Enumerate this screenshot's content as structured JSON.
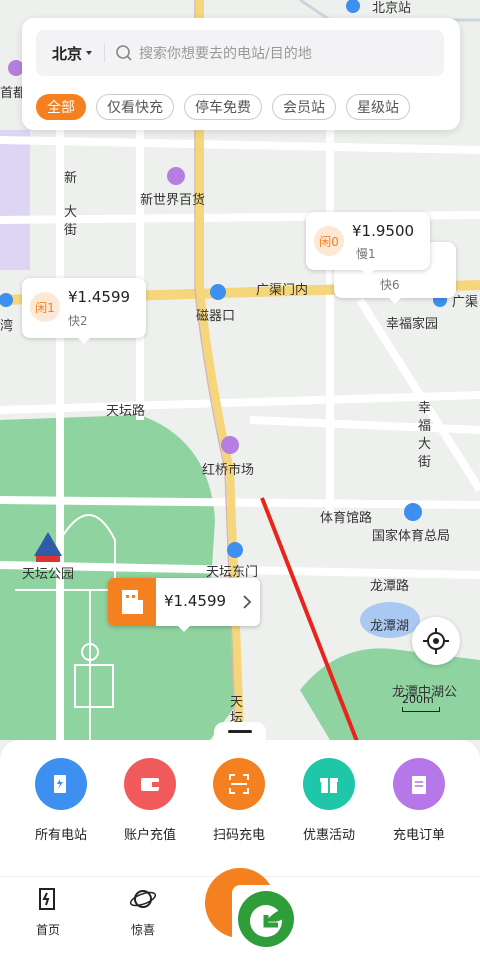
{
  "search": {
    "city": "北京",
    "placeholder": "搜索你想要去的电站/目的地"
  },
  "filters": [
    "全部",
    "仅看快充",
    "停车免费",
    "会员站",
    "星级站"
  ],
  "map_labels": {
    "beijing_station": "北京站",
    "capital": "首都",
    "xinshijie": "新世界百货",
    "xinfang": "新",
    "xinfang2": "大",
    "xinfang3": "街",
    "guangqu": "广渠门内",
    "cikou": "磁器口",
    "xingfu": "幸福家园",
    "tiantan_road": "天坛路",
    "hongqiao": "红桥市场",
    "tiyu": "体育馆路",
    "guojia": "国家体育总局",
    "tiantan_park": "天坛公园",
    "tiantan_dongmen": "天坛东门",
    "longtan_road": "龙潭路",
    "longtan_lake": "龙潭湖",
    "longtan_zhonghu": "龙潭中湖公",
    "xingfu_st1": "幸",
    "xingfu_st2": "福",
    "xingfu_st3": "大",
    "xingfu_st4": "街",
    "tian1": "天",
    "tian2": "坛",
    "wan": "湾",
    "guangqu_w": "广渠"
  },
  "pins": [
    {
      "badge": "闲1",
      "price": "¥1.4599",
      "sub": "快2"
    },
    {
      "badge": "闲0",
      "price": "¥1.9500",
      "sub": "慢1"
    },
    {
      "badge": "闲",
      "price": "",
      "sub": "快6"
    }
  ],
  "featured_pin": {
    "price": "¥1.4599"
  },
  "scale": "200m",
  "functions": [
    {
      "label": "所有电站",
      "color": "#3d8ff0"
    },
    {
      "label": "账户充值",
      "color": "#f05a5a"
    },
    {
      "label": "扫码充电",
      "color": "#f4801f"
    },
    {
      "label": "优惠活动",
      "color": "#1fc7a8"
    },
    {
      "label": "充电订单",
      "color": "#b678e8"
    }
  ],
  "tabs": [
    {
      "label": "首页"
    },
    {
      "label": "惊喜"
    }
  ],
  "colors": {
    "accent": "#f4801f",
    "park": "#7ccc8f",
    "arrow": "#e8241c"
  }
}
